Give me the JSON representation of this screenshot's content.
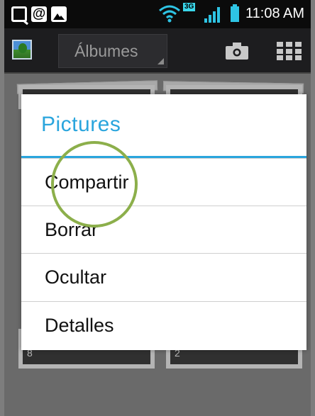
{
  "status_bar": {
    "time": "11:08 AM",
    "network_type": "3G",
    "icons": [
      "q-icon",
      "at-icon",
      "image-icon",
      "wifi-icon",
      "signal-icon",
      "battery-icon"
    ]
  },
  "action_bar": {
    "app_icon": "gallery-icon",
    "spinner_label": "Álbumes",
    "actions": [
      "camera-icon",
      "grid-view-icon"
    ]
  },
  "albums": {
    "counts": [
      "8",
      "2"
    ]
  },
  "dialog": {
    "title": "Pictures",
    "items": [
      {
        "label": "Compartir"
      },
      {
        "label": "Borrar"
      },
      {
        "label": "Ocultar"
      },
      {
        "label": "Detalles"
      }
    ]
  },
  "colors": {
    "accent": "#2aa5dd",
    "status_bar_bg": "#0b0b0b",
    "action_bar_bg": "#1d1d1f",
    "tap_indicator": "#8caf4b"
  }
}
